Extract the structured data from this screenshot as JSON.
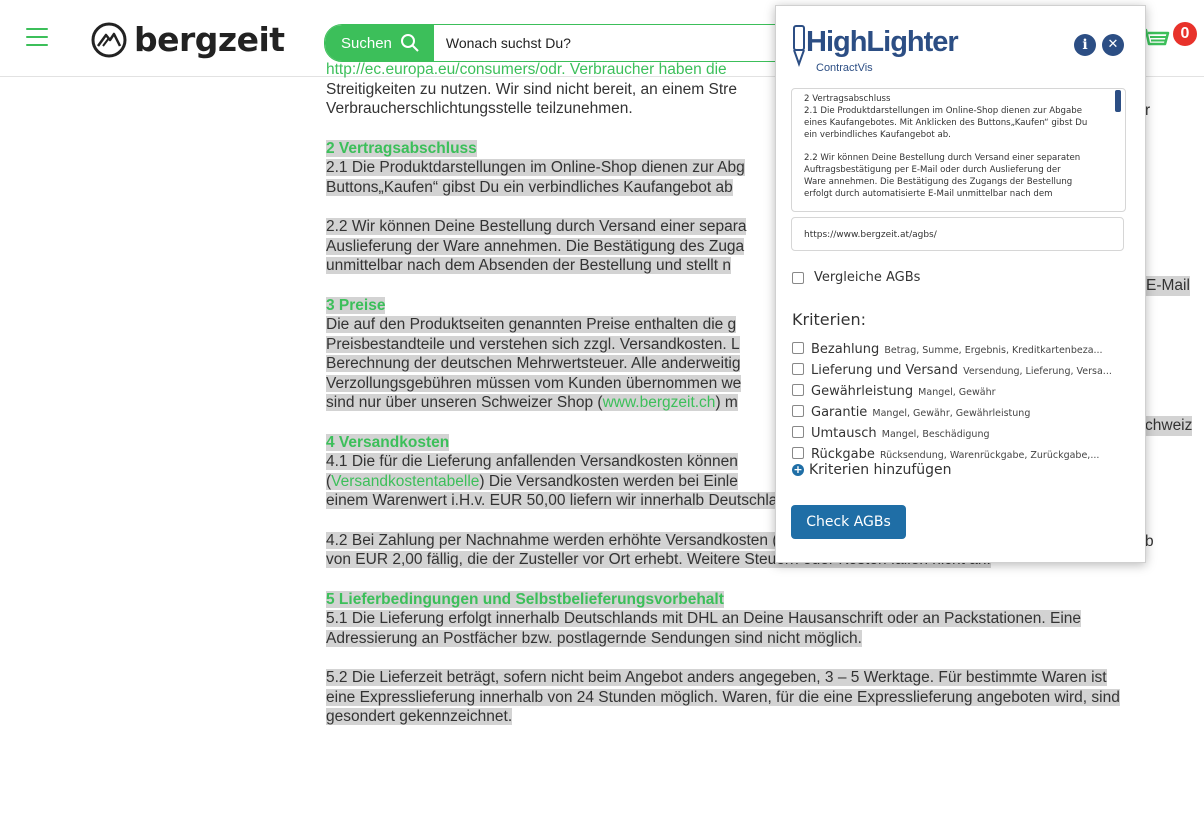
{
  "header": {
    "logo_text": "bergzeit",
    "search_label": "Suchen",
    "search_placeholder": "Wonach suchst Du?",
    "cart_count": "0"
  },
  "content": {
    "top_fragment": "http://ec.europa.eu/consumers/odr. Verbraucher haben die",
    "top_fragment_end": "r",
    "top_line2": "Streitigkeiten zu nutzen. Wir sind nicht bereit, an einem Stre",
    "top_line3": "Verbraucherschlichtungsstelle teilzunehmen.",
    "s2_head": "2 Vertragsabschluss",
    "s2_p1_l1": "2.1 Die Produktdarstellungen im Online-Shop dienen zur Abg",
    "s2_p1_l2": "Buttons„Kaufen“ gibst Du ein verbindliches Kaufangebot ab",
    "s2_p2_l1": "2.2 Wir können Deine Bestellung durch Versand einer separa",
    "s2_p2_l2": "Auslieferung der Ware annehmen. Die Bestätigung des Zuga",
    "s2_p2_l2_end": "E-Mail",
    "s2_p2_l3": "unmittelbar nach dem Absenden der Bestellung und stellt n",
    "s3_head": "3 Preise",
    "s3_l1": "Die auf den Produktseiten genannten Preise enthalten die g",
    "s3_l2": "Preisbestandteile und verstehen sich zzgl. Versandkosten. L",
    "s3_l3": "Berechnung der deutschen Mehrwertsteuer. Alle anderweitig",
    "s3_l4": "Verzollungsgebühren müssen vom Kunden übernommen we",
    "s3_l4_end": "chweiz",
    "s3_l5_a": "sind nur über unseren Schweizer Shop (",
    "s3_l5_link": "www.bergzeit.ch",
    "s3_l5_b": ") m",
    "s4_head": "4 Versandkosten",
    "s4_l1": "4.1 Die für die Lieferung anfallenden Versandkosten können",
    "s4_l2_a": "(",
    "s4_l2_link": "Versandkostentabelle",
    "s4_l2_b": ") Die Versandkosten werden bei Einle",
    "s4_l2_end": "b",
    "s4_l3": "einem Warenwert i.H.v. EUR 50,00 liefern wir innerhalb Deutschlands versandkostenfrei.",
    "s4_p2_l1": "4.2 Bei Zahlung per Nachnahme werden erhöhte Versandkosten (EUR 4,00) sowie eine zusätzliche Gebühr in Höhe",
    "s4_p2_l2": "von EUR 2,00 fällig, die der Zusteller vor Ort erhebt. Weitere Steuern oder Kosten fallen nicht an.",
    "s5_head": "5 Lieferbedingungen und Selbstbelieferungsvorbehalt",
    "s5_l1": "5.1 Die Lieferung erfolgt innerhalb Deutschlands mit DHL an Deine Hausanschrift oder an Packstationen. Eine",
    "s5_l2": "Adressierung an Postfächer bzw. postlagernde Sendungen sind nicht möglich.",
    "s5_p2_l1": "5.2 Die Lieferzeit beträgt, sofern nicht beim Angebot anders angegeben, 3 – 5 Werktage. Für bestimmte Waren ist",
    "s5_p2_l2": "eine Expresslieferung innerhalb von 24 Stunden möglich. Waren, für die eine Expresslieferung angeboten wird, sind",
    "s5_p2_l3": "gesondert gekennzeichnet."
  },
  "popup": {
    "title": "HighLighter",
    "subtitle": "ContractVis",
    "text_p1_l1": "2 Vertragsabschluss",
    "text_p1_l2": "2.1 Die Produktdarstellungen im Online-Shop dienen zur Abgabe",
    "text_p1_l3": "eines Kaufangebotes. Mit Anklicken des Buttons„Kaufen“ gibst Du",
    "text_p1_l4": "ein verbindliches Kaufangebot ab.",
    "text_p2_l1": "2.2 Wir können Deine Bestellung durch Versand einer separaten",
    "text_p2_l2": "Auftragsbestätigung per E-Mail oder durch Auslieferung der",
    "text_p2_l3": "Ware annehmen. Die Bestätigung des Zugangs der Bestellung",
    "text_p2_l4": "erfolgt durch automatisierte E-Mail unmittelbar nach dem",
    "url": "https://www.bergzeit.at/agbs/",
    "compare_label": "Vergleiche AGBs",
    "criteria_title": "Kriterien:",
    "criteria": [
      {
        "name": "Bezahlung",
        "keywords": "Betrag, Summe, Ergebnis, Kreditkartenbeza..."
      },
      {
        "name": "Lieferung und Versand",
        "keywords": "Versendung, Lieferung, Versa..."
      },
      {
        "name": "Gewährleistung",
        "keywords": "Mangel, Gewähr"
      },
      {
        "name": "Garantie",
        "keywords": "Mangel, Gewähr, Gewährleistung"
      },
      {
        "name": "Umtausch",
        "keywords": "Mangel, Beschädigung"
      },
      {
        "name": "Rückgabe",
        "keywords": "Rücksendung, Warenrückgabe, Zurückgabe,..."
      }
    ],
    "add_criteria": "Kriterien hinzufügen",
    "check_button": "Check AGBs",
    "info_icon": "info-icon",
    "close_icon": "close-icon"
  },
  "colors": {
    "brand_green": "#3cbf5a",
    "highlighter_blue": "#2c4e84",
    "button_blue": "#1f6ea6",
    "badge_red": "#e8322b",
    "highlight_grey": "#d3d3d3"
  }
}
